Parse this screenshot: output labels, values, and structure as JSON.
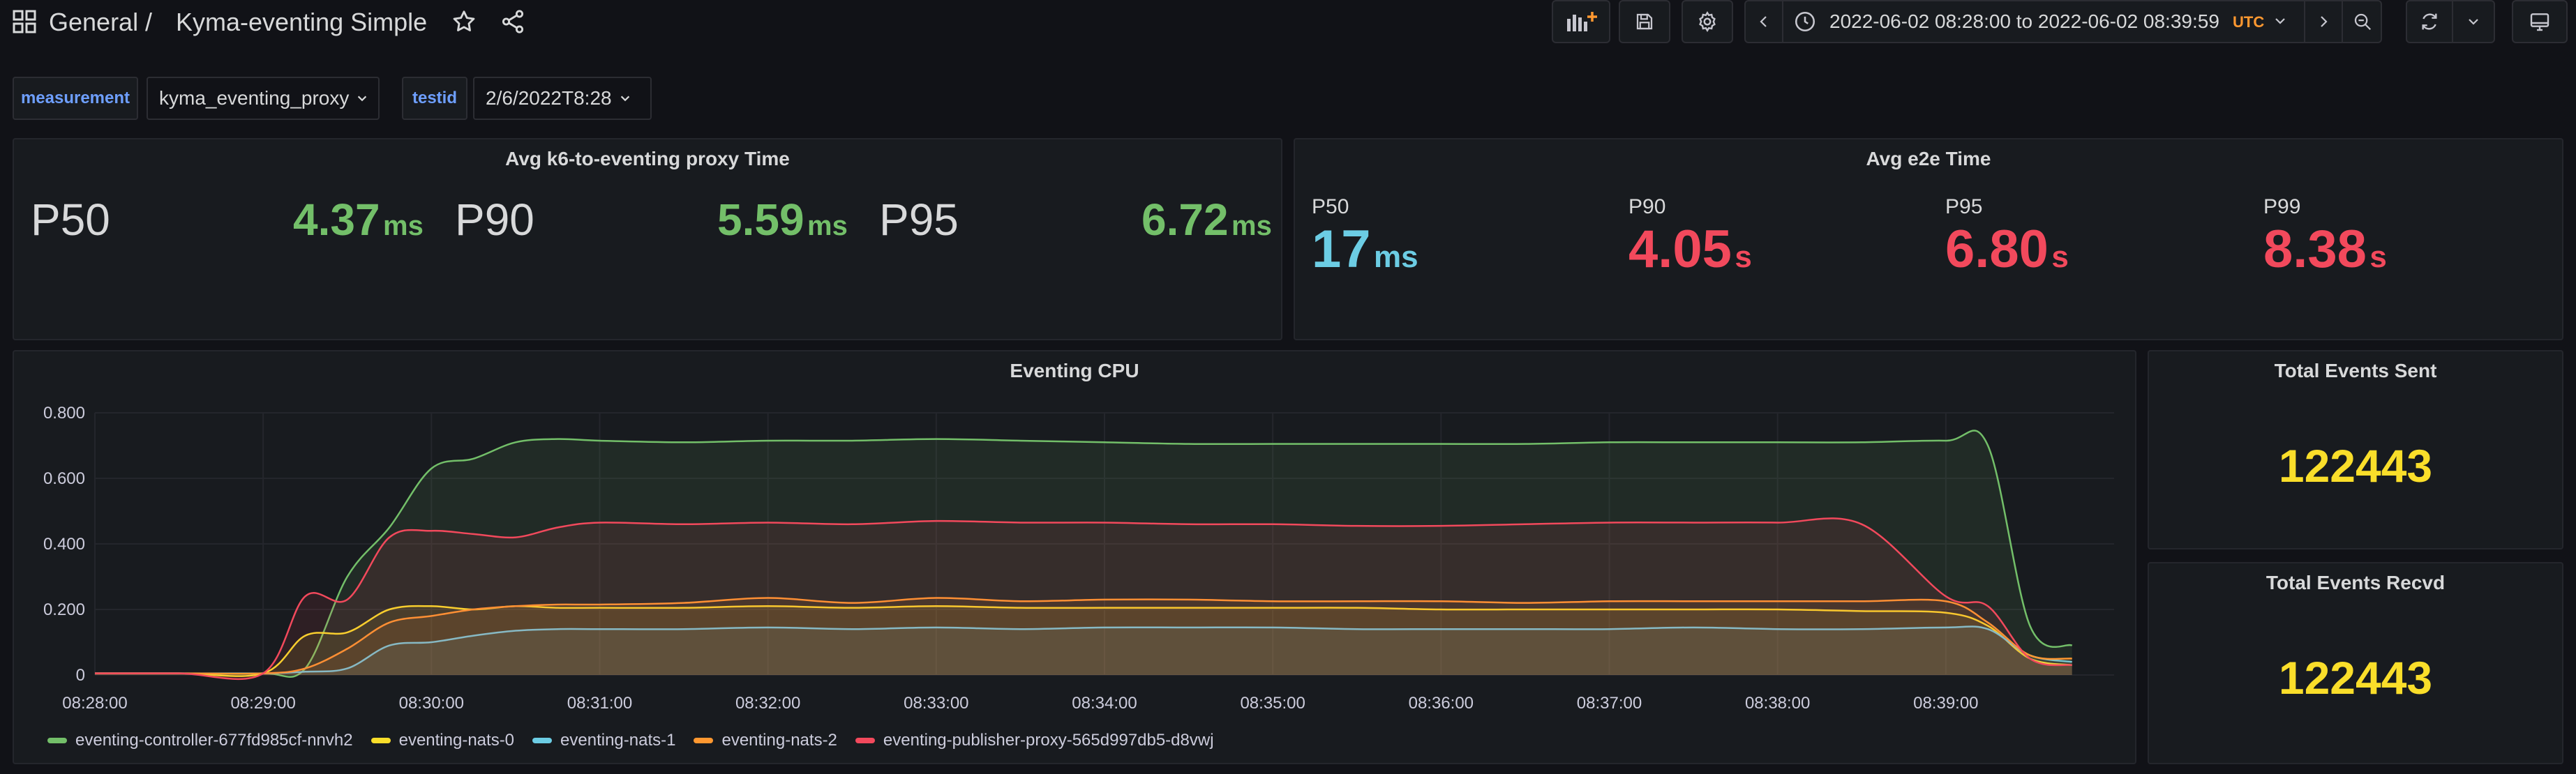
{
  "nav": {
    "folder": "General",
    "separator": "/",
    "dashboard_title": "Kyma-eventing Simple",
    "time_range": "2022-06-02 08:28:00 to 2022-06-02 08:39:59",
    "timezone": "UTC"
  },
  "variables": [
    {
      "label": "measurement",
      "value": "kyma_eventing_proxy"
    },
    {
      "label": "testid",
      "value": "2/6/2022T8:28"
    }
  ],
  "proxy_panel": {
    "title": "Avg k6-to-eventing proxy Time",
    "stats": [
      {
        "label": "P50",
        "value": "4.37",
        "unit": "ms"
      },
      {
        "label": "P90",
        "value": "5.59",
        "unit": "ms"
      },
      {
        "label": "P95",
        "value": "6.72",
        "unit": "ms"
      }
    ]
  },
  "e2e_panel": {
    "title": "Avg e2e Time",
    "stats": [
      {
        "label": "P50",
        "value": "17",
        "unit": "ms",
        "color": "#6ccde4"
      },
      {
        "label": "P90",
        "value": "4.05",
        "unit": "s",
        "color": "#f2495c"
      },
      {
        "label": "P95",
        "value": "6.80",
        "unit": "s",
        "color": "#f2495c"
      },
      {
        "label": "P99",
        "value": "8.38",
        "unit": "s",
        "color": "#f2495c"
      }
    ]
  },
  "cpu_panel": {
    "title": "Eventing CPU"
  },
  "events_sent": {
    "title": "Total Events Sent",
    "value": "122443"
  },
  "events_recvd": {
    "title": "Total Events Recvd",
    "value": "122443"
  },
  "chart_data": {
    "type": "area",
    "title": "Eventing CPU",
    "x": [
      "08:28:00",
      "08:28:30",
      "08:29:00",
      "08:29:15",
      "08:29:30",
      "08:29:45",
      "08:30:00",
      "08:30:15",
      "08:30:30",
      "08:30:45",
      "08:31:00",
      "08:31:30",
      "08:32:00",
      "08:32:30",
      "08:33:00",
      "08:33:30",
      "08:34:00",
      "08:34:30",
      "08:35:00",
      "08:35:30",
      "08:36:00",
      "08:36:30",
      "08:37:00",
      "08:37:30",
      "08:38:00",
      "08:38:30",
      "08:39:00",
      "08:39:15",
      "08:39:30",
      "08:39:45"
    ],
    "x_ticks": [
      "08:28:00",
      "08:29:00",
      "08:30:00",
      "08:31:00",
      "08:32:00",
      "08:33:00",
      "08:34:00",
      "08:35:00",
      "08:36:00",
      "08:37:00",
      "08:38:00",
      "08:39:00"
    ],
    "y_ticks": [
      "0",
      "0.200",
      "0.400",
      "0.600",
      "0.800"
    ],
    "ylim": [
      0,
      0.8
    ],
    "series": [
      {
        "name": "eventing-controller-677fd985cf-nnvh2",
        "color": "#73bf69",
        "values": [
          0.005,
          0.005,
          0.005,
          0.02,
          0.3,
          0.45,
          0.63,
          0.66,
          0.71,
          0.72,
          0.715,
          0.71,
          0.715,
          0.715,
          0.72,
          0.715,
          0.71,
          0.705,
          0.705,
          0.705,
          0.705,
          0.705,
          0.71,
          0.71,
          0.71,
          0.71,
          0.715,
          0.7,
          0.15,
          0.09
        ]
      },
      {
        "name": "eventing-nats-0",
        "color": "#fade2a",
        "values": [
          0.005,
          0.005,
          0.005,
          0.12,
          0.13,
          0.2,
          0.21,
          0.2,
          0.21,
          0.205,
          0.205,
          0.205,
          0.21,
          0.205,
          0.21,
          0.205,
          0.205,
          0.205,
          0.205,
          0.205,
          0.2,
          0.2,
          0.2,
          0.2,
          0.2,
          0.195,
          0.19,
          0.15,
          0.05,
          0.03
        ]
      },
      {
        "name": "eventing-nats-1",
        "color": "#6ccde4",
        "values": [
          0.005,
          0.005,
          0.005,
          0.01,
          0.02,
          0.09,
          0.1,
          0.12,
          0.135,
          0.14,
          0.14,
          0.14,
          0.145,
          0.14,
          0.145,
          0.14,
          0.145,
          0.145,
          0.145,
          0.14,
          0.14,
          0.14,
          0.14,
          0.145,
          0.14,
          0.14,
          0.145,
          0.14,
          0.06,
          0.04
        ]
      },
      {
        "name": "eventing-nats-2",
        "color": "#ff9830",
        "values": [
          0.005,
          0.005,
          0.005,
          0.02,
          0.08,
          0.16,
          0.18,
          0.2,
          0.21,
          0.215,
          0.215,
          0.22,
          0.235,
          0.22,
          0.235,
          0.225,
          0.23,
          0.23,
          0.225,
          0.225,
          0.225,
          0.22,
          0.225,
          0.225,
          0.225,
          0.225,
          0.225,
          0.16,
          0.06,
          0.05
        ]
      },
      {
        "name": "eventing-publisher-proxy-565d997db5-d8vwj",
        "color": "#f2495c",
        "values": [
          0.005,
          0.005,
          0.005,
          0.24,
          0.23,
          0.42,
          0.44,
          0.43,
          0.42,
          0.45,
          0.465,
          0.46,
          0.465,
          0.46,
          0.47,
          0.465,
          0.465,
          0.46,
          0.46,
          0.455,
          0.455,
          0.46,
          0.465,
          0.465,
          0.465,
          0.46,
          0.24,
          0.21,
          0.05,
          0.03
        ]
      }
    ]
  }
}
